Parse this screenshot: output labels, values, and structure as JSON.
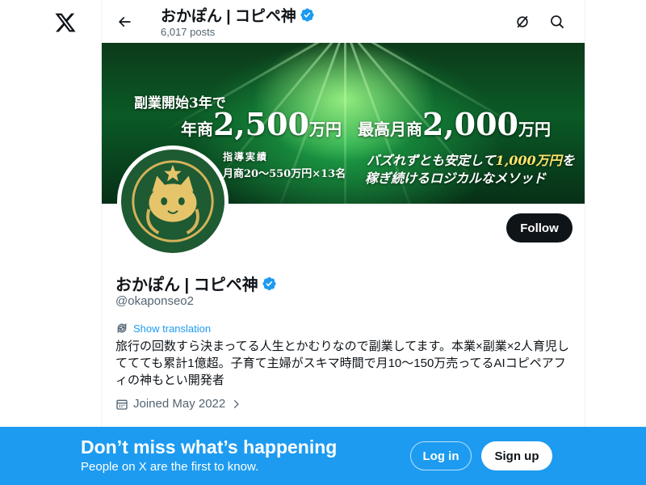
{
  "header": {
    "title": "おかぽん | コピペ神",
    "posts": "6,017 posts"
  },
  "banner": {
    "line1": "副業開始3年で",
    "line2_prefix": "年商",
    "line2_big1": "2,500",
    "line2_unit1": "万円　最高月商",
    "line2_big2": "2,000",
    "line2_unit2": "万円",
    "line3": "指導実績",
    "line4": "月商20〜550万円×13名",
    "line5_prefix": "バズれずとも安定して",
    "line5_highlight": "1,000万円",
    "line5_suffix": "を",
    "line6": "稼ぎ続けるロジカルなメソッド"
  },
  "profile": {
    "name": "おかぽん | コピペ神",
    "handle": "@okaponseo2",
    "follow_label": "Follow",
    "translate_label": "Show translation",
    "bio": "旅行の回数すら決まってる人生とかむりなので副業してます。本業×副業×2人育児しててても累計1億超。子育て主婦がスキマ時間で月10〜150万売ってるAIコピペアフィの神もとい開発者",
    "joined": "Joined May 2022"
  },
  "bottom_bar": {
    "title": "Don’t miss what’s happening",
    "subtitle": "People on X are the first to know.",
    "login_label": "Log in",
    "signup_label": "Sign up"
  },
  "colors": {
    "accent": "#1d9bf0",
    "text": "#0f1419",
    "secondary": "#536471"
  },
  "icons": [
    "x-logo-icon",
    "back-arrow-icon",
    "verified-badge-icon",
    "grok-icon",
    "search-icon",
    "translate-icon",
    "calendar-icon",
    "chevron-right-icon"
  ]
}
